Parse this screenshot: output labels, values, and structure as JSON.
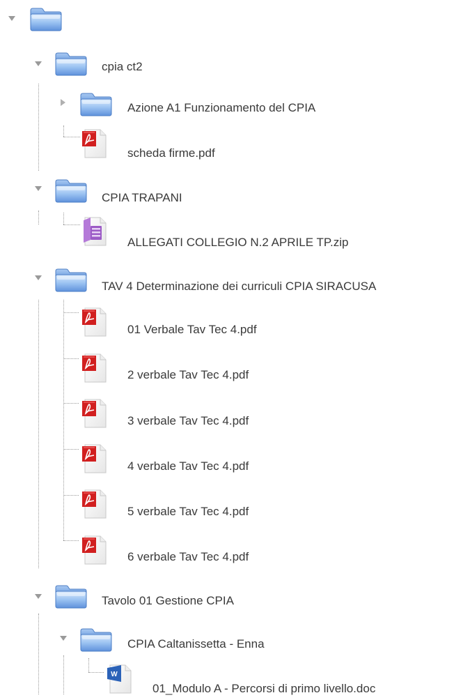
{
  "tree": {
    "root": {
      "label": "",
      "expanded": true,
      "icon": "folder-icon"
    },
    "folders": {
      "cpia_ct2": {
        "label": "cpia ct2",
        "expanded": true,
        "children": {
          "azione_a1": {
            "label": "Azione A1 Funzionamento del CPIA",
            "expanded": false,
            "icon": "folder-icon"
          },
          "scheda_firme": {
            "label": "scheda firme.pdf",
            "icon": "pdf-file-icon"
          }
        }
      },
      "cpia_trapani": {
        "label": "CPIA TRAPANI",
        "expanded": true,
        "children": {
          "allegati": {
            "label": "ALLEGATI COLLEGIO N.2 APRILE TP.zip",
            "icon": "zip-file-icon"
          }
        }
      },
      "tav4": {
        "label": "TAV 4 Determinazione dei curriculi CPIA SIRACUSA",
        "expanded": true,
        "children": [
          {
            "label": "01 Verbale Tav Tec 4.pdf",
            "icon": "pdf-file-icon"
          },
          {
            "label": "2 verbale Tav Tec 4.pdf",
            "icon": "pdf-file-icon"
          },
          {
            "label": "3 verbale Tav Tec 4.pdf",
            "icon": "pdf-file-icon"
          },
          {
            "label": "4 verbale Tav Tec 4.pdf",
            "icon": "pdf-file-icon"
          },
          {
            "label": "5 verbale Tav Tec 4.pdf",
            "icon": "pdf-file-icon"
          },
          {
            "label": "6 verbale Tav Tec 4.pdf",
            "icon": "pdf-file-icon"
          }
        ]
      },
      "tavolo01": {
        "label": "Tavolo 01 Gestione CPIA",
        "expanded": true,
        "children": {
          "cpia_caltanissetta": {
            "label": "CPIA Caltanissetta - Enna",
            "expanded": true,
            "children": {
              "modulo_a": {
                "label": "01_Modulo A - Percorsi di primo livello.doc",
                "icon": "word-file-icon"
              }
            }
          }
        }
      }
    }
  },
  "colors": {
    "folder_light": "#cfe3fb",
    "folder_mid": "#8fbaf0",
    "folder_dark": "#4f86d3",
    "pdf_red": "#d21f1f",
    "zip_purple": "#9a5cc4",
    "word_blue": "#2b62b8",
    "text": "#3a3a3a",
    "guide_line": "#9a9a9a",
    "twisty": "#9a9a9a"
  }
}
